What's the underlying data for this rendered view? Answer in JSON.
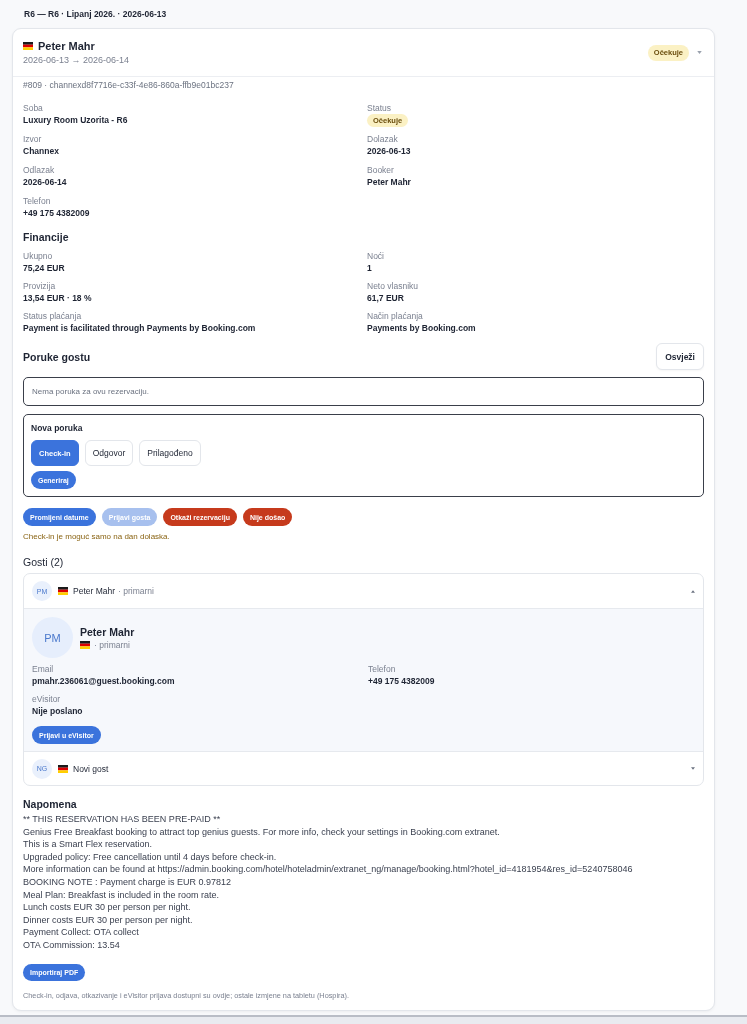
{
  "page_title": "R6 — R6 · Lipanj 2026. · 2026-06-13",
  "reservation": {
    "guest_name": "Peter Mahr",
    "dates": "2026-06-13 → 2026-06-14",
    "status": "Očekuje",
    "reference": "#809 · channexd8f7716e-c33f-4e86-860a-ffb9e01bc237"
  },
  "details": [
    {
      "label": "Soba",
      "value": "Luxury Room Uzorita - R6",
      "kind": "text"
    },
    {
      "label": "Status",
      "value": "Očekuje",
      "kind": "badge"
    },
    {
      "label": "Izvor",
      "value": "Channex",
      "kind": "text"
    },
    {
      "label": "Dolazak",
      "value": "2026-06-13",
      "kind": "text"
    },
    {
      "label": "Odlazak",
      "value": "2026-06-14",
      "kind": "text"
    },
    {
      "label": "Booker",
      "value": "Peter Mahr",
      "kind": "text"
    },
    {
      "label": "Telefon",
      "value": "+49 175 4382009",
      "kind": "text"
    }
  ],
  "finance": {
    "title": "Financije",
    "fields": [
      {
        "label": "Ukupno",
        "value": "75,24 EUR"
      },
      {
        "label": "Noći",
        "value": "1"
      },
      {
        "label": "Provizija",
        "value": "13,54 EUR · 18 %"
      },
      {
        "label": "Neto vlasniku",
        "value": "61,7 EUR"
      },
      {
        "label": "Status plaćanja",
        "value": "Payment is facilitated through Payments by Booking.com"
      },
      {
        "label": "Način plaćanja",
        "value": "Payments by Booking.com"
      }
    ]
  },
  "messages": {
    "title": "Poruke gostu",
    "refresh_button": "Osvježi",
    "empty_text": "Nema poruka za ovu rezervaciju.",
    "composer": {
      "title": "Nova poruka",
      "templates": [
        {
          "label": "Check-in",
          "selected": true
        },
        {
          "label": "Odgovor",
          "selected": false
        },
        {
          "label": "Prilagođeno",
          "selected": false
        }
      ],
      "generate_button": "Generiraj"
    }
  },
  "actions": [
    {
      "label": "Promijeni datume",
      "kind": "primary",
      "disabled": false
    },
    {
      "label": "Prijavi gosta",
      "kind": "primary",
      "disabled": true
    },
    {
      "label": "Otkaži rezervaciju",
      "kind": "danger",
      "disabled": false
    },
    {
      "label": "Nije došao",
      "kind": "danger",
      "disabled": false
    }
  ],
  "warning": "Check-in je moguć samo na dan dolaska.",
  "guests": {
    "title": "Gosti (2)",
    "items": [
      {
        "initials": "PM",
        "name": "Peter Mahr",
        "role": "· primarni",
        "expanded": true,
        "detail": {
          "initials": "PM",
          "name": "Peter Mahr",
          "role": "· primarni",
          "fields": [
            {
              "label": "Email",
              "value": "pmahr.236061@guest.booking.com"
            },
            {
              "label": "Telefon",
              "value": "+49 175 4382009"
            },
            {
              "label": "eVisitor",
              "value": "Nije poslano"
            }
          ],
          "button": "Prijavi u eVisitor"
        }
      },
      {
        "initials": "NG",
        "name": "Novi gost",
        "expanded": false
      }
    ]
  },
  "note": {
    "title": "Napomena",
    "lines": [
      "** THIS RESERVATION HAS BEEN PRE-PAID **",
      "Genius Free Breakfast booking to attract top genius guests. For more info, check your settings in Booking.com extranet.",
      "This is a Smart Flex reservation.",
      "Upgraded policy: Free cancellation until 4 days before check-in.",
      "More information can be found at https://admin.booking.com/hotel/hoteladmin/extranet_ng/manage/booking.html?hotel_id=4181954&res_id=5240758046",
      "BOOKING NOTE : Payment charge is EUR 0.97812",
      "Meal Plan: Breakfast is included in the room rate.",
      "Lunch costs EUR 30 per person per night.",
      "Dinner costs EUR 30 per person per night.",
      "Payment Collect: OTA collect",
      "OTA Commission: 13.54"
    ]
  },
  "import_button": "Importiraj PDF",
  "footer_note": "Check-in, odjava, otkazivanje i eVisitor prijava dostupni su ovdje; ostale izmjene na tabletu (Hospira)."
}
